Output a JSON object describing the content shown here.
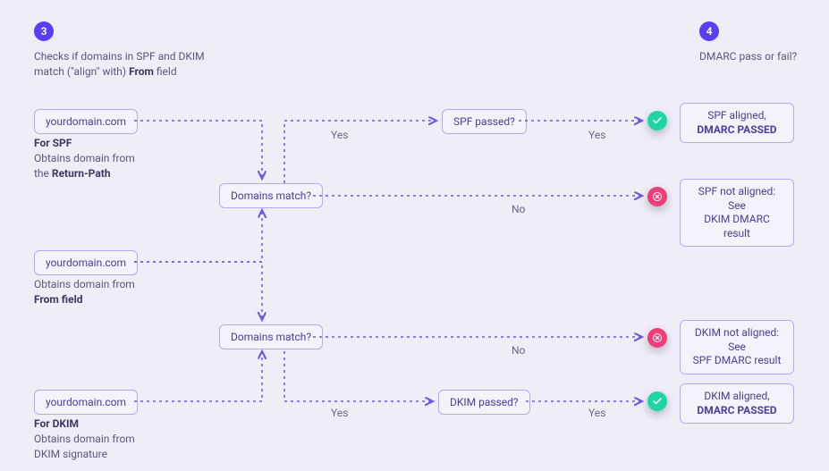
{
  "step3": {
    "number": "3",
    "title_a": "Checks if domains in SPF and DKIM",
    "title_b": "match (\"align\" with) ",
    "title_c": "From",
    "title_d": " field"
  },
  "step4": {
    "number": "4",
    "title": "DMARC pass or fail?"
  },
  "nodes": {
    "spf_domain": "yourdomain.com",
    "from_domain": "yourdomain.com",
    "dkim_domain": "yourdomain.com",
    "domains_match_1": "Domains match?",
    "domains_match_2": "Domains match?",
    "spf_passed": "SPF passed?",
    "dkim_passed": "DKIM passed?"
  },
  "captions": {
    "spf_a": "For SPF",
    "spf_b": "Obtains domain from",
    "spf_c": "the ",
    "spf_d": "Return-Path",
    "from_a": "Obtains domain from",
    "from_b": "From field",
    "dkim_a": "For DKIM",
    "dkim_b": "Obtains domain from",
    "dkim_c": "DKIM signature"
  },
  "edges": {
    "yes": "Yes",
    "no": "No"
  },
  "outcomes": {
    "spf_pass_a": "SPF aligned,",
    "spf_pass_b": "DMARC PASSED",
    "spf_fail_a": "SPF not aligned: See",
    "spf_fail_b": "DKIM DMARC result",
    "dkim_fail_a": "DKIM not aligned: See",
    "dkim_fail_b": "SPF DMARC result",
    "dkim_pass_a": "DKIM aligned,",
    "dkim_pass_b": "DMARC PASSED"
  },
  "colors": {
    "stroke": "#6f56e8"
  }
}
